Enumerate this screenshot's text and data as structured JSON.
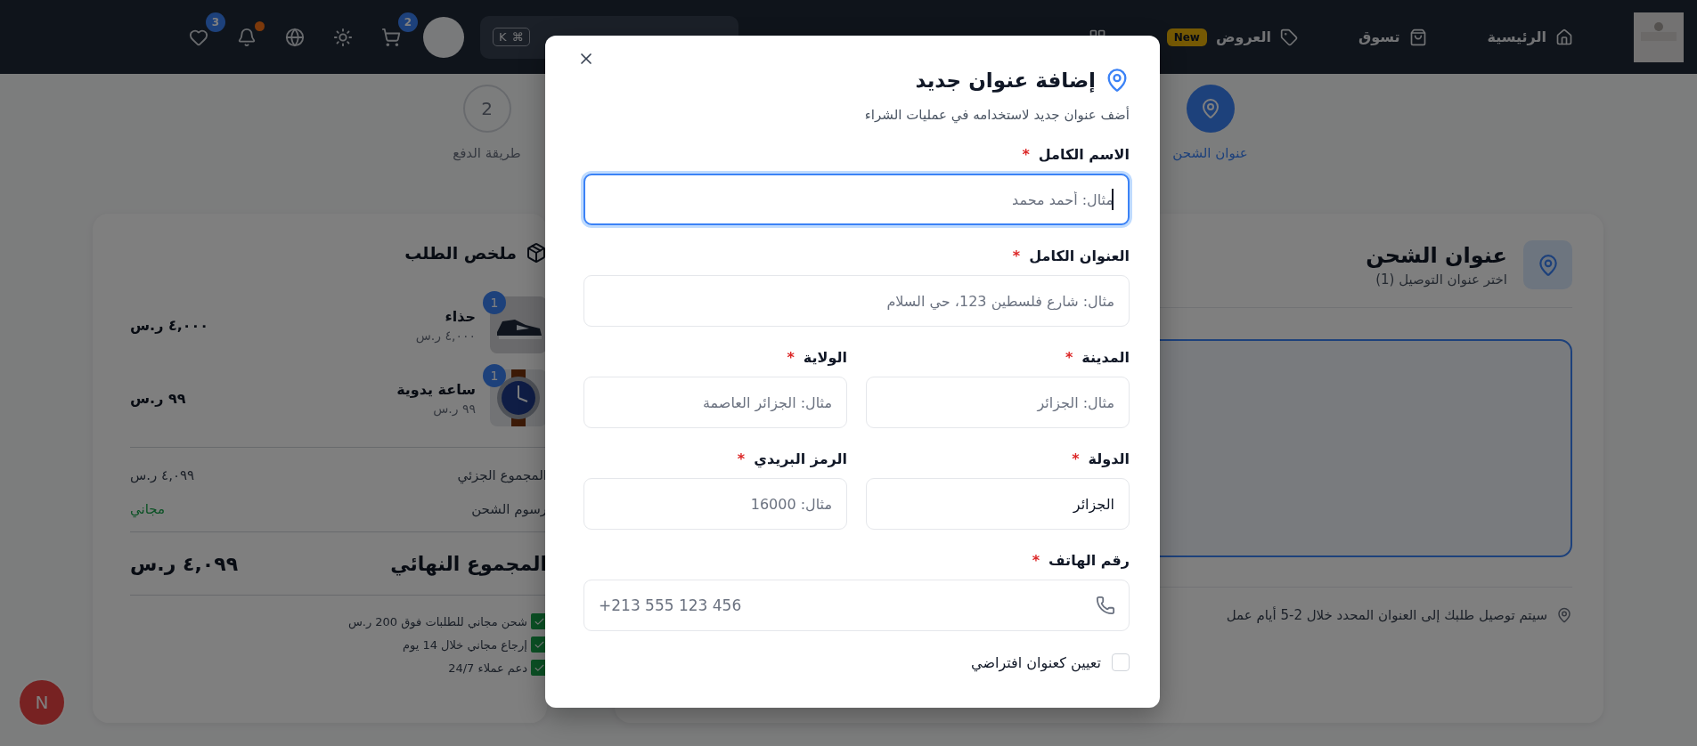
{
  "navbar": {
    "links": [
      {
        "kind": "home",
        "label": "الرئيسية"
      },
      {
        "kind": "shop",
        "label": "تسوق"
      },
      {
        "kind": "offers",
        "label": "العروض",
        "badge": "New"
      },
      {
        "kind": "categories"
      }
    ],
    "search": {
      "shortcut": [
        "⌘",
        "K"
      ]
    },
    "actions": [
      {
        "kind": "cart",
        "badge": "2"
      },
      {
        "kind": "theme"
      },
      {
        "kind": "language"
      },
      {
        "kind": "notifications",
        "unread": true
      },
      {
        "kind": "wishlist",
        "badge": "3"
      }
    ]
  },
  "steps": [
    {
      "label": "عنوان الشحن",
      "selected": true
    },
    {
      "label": "طريقة الدفع",
      "number": "2",
      "selected": false
    }
  ],
  "shipping": {
    "title": "عنوان الشحن",
    "subtitle": "اختر عنوان التوصيل (1)",
    "note": "سيتم توصيل طلبك إلى العنوان المحدد خلال 2-5 أيام عمل"
  },
  "summary": {
    "title": "ملخص الطلب",
    "items": [
      {
        "kind": "shoe",
        "name": "حذاء",
        "quantity": "1",
        "unit_price": "٤,٠٠٠ ر.س",
        "total": "٤,٠٠٠ ر.س"
      },
      {
        "kind": "watch",
        "name": "ساعة يدوية",
        "quantity": "1",
        "unit_price": "٩٩ ر.س",
        "total": "٩٩ ر.س"
      }
    ],
    "subtotal": {
      "label": "المجموع الجزئي",
      "value": "٤,٠٩٩ ر.س"
    },
    "shipping_fee": {
      "label": "رسوم الشحن",
      "value": "مجاني"
    },
    "total": {
      "label": "المجموع النهائي",
      "value": "٤,٠٩٩ ر.س"
    },
    "features": [
      "شحن مجاني للطلبات فوق 200 ر.س",
      "إرجاع مجاني خلال 14 يوم",
      "دعم عملاء 24/7"
    ]
  },
  "dialog": {
    "title": "إضافة عنوان جديد",
    "subtitle": "أضف عنوان جديد لاستخدامه في عمليات الشراء",
    "rows": [
      [
        {
          "label": "الاسم الكامل",
          "required_mark": "*",
          "placeholder": "مثال: أحمد محمد",
          "focused": true
        }
      ],
      [
        {
          "label": "العنوان الكامل",
          "required_mark": "*",
          "placeholder": "مثال: شارع فلسطين 123، حي السلام",
          "focused": false
        }
      ],
      [
        {
          "label": "المدينة",
          "required_mark": "*",
          "placeholder": "مثال: الجزائر",
          "focused": false
        },
        {
          "label": "الولاية",
          "required_mark": "*",
          "placeholder": "مثال: الجزائر العاصمة",
          "focused": false
        }
      ],
      [
        {
          "label": "الدولة",
          "required_mark": "*",
          "value": "الجزائر",
          "focused": false
        },
        {
          "label": "الرمز البريدي",
          "required_mark": "*",
          "placeholder": "مثال: 16000",
          "focused": false
        }
      ],
      [
        {
          "label": "رقم الهاتف",
          "required_mark": "*",
          "placeholder": "+213 555 123 456",
          "kind": "phone",
          "focused": false
        }
      ]
    ],
    "default_checkbox": {
      "label": "تعيين كعنوان افتراضي",
      "checked": false
    }
  },
  "dev_badge": {
    "label": "N"
  }
}
